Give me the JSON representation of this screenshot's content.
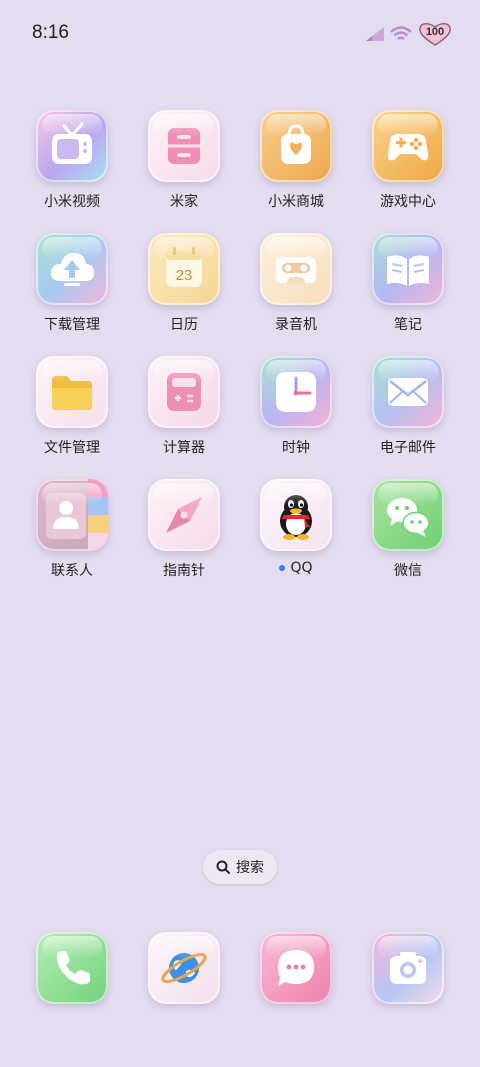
{
  "status_bar": {
    "time": "8:16",
    "battery": "100",
    "signal_icon": "cellular-signal-icon",
    "wifi_icon": "wifi-icon",
    "battery_icon": "heart-battery-icon"
  },
  "apps": [
    {
      "label": "小米视频",
      "icon": "tv-icon"
    },
    {
      "label": "米家",
      "icon": "cabinet-icon"
    },
    {
      "label": "小米商城",
      "icon": "shopping-bag-icon"
    },
    {
      "label": "游戏中心",
      "icon": "gamepad-icon"
    },
    {
      "label": "下载管理",
      "icon": "cloud-upload-icon"
    },
    {
      "label": "日历",
      "icon": "calendar-icon",
      "date": "23"
    },
    {
      "label": "录音机",
      "icon": "cassette-icon"
    },
    {
      "label": "笔记",
      "icon": "open-book-icon"
    },
    {
      "label": "文件管理",
      "icon": "folder-icon"
    },
    {
      "label": "计算器",
      "icon": "calculator-icon"
    },
    {
      "label": "时钟",
      "icon": "clock-icon"
    },
    {
      "label": "电子邮件",
      "icon": "envelope-icon"
    },
    {
      "label": "联系人",
      "icon": "contact-icon"
    },
    {
      "label": "指南针",
      "icon": "compass-icon"
    },
    {
      "label": "QQ",
      "icon": "penguin-icon",
      "new_badge": true
    },
    {
      "label": "微信",
      "icon": "chat-bubbles-icon"
    }
  ],
  "search": {
    "label": "搜索",
    "icon": "search-icon"
  },
  "dock": [
    {
      "name": "phone",
      "icon": "phone-icon"
    },
    {
      "name": "browser",
      "icon": "globe-icon"
    },
    {
      "name": "messages",
      "icon": "message-icon"
    },
    {
      "name": "camera",
      "icon": "camera-icon"
    }
  ],
  "colors": {
    "background": "#e4dcef",
    "badge_dot": "#3b7cff"
  }
}
